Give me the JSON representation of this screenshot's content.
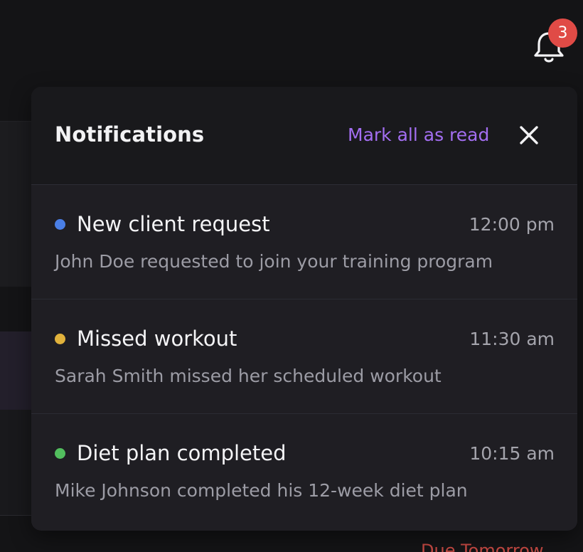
{
  "bell": {
    "icon": "bell-icon",
    "badge_count": "3",
    "badge_color": "#e04b46"
  },
  "background": {
    "due_label": "Due Tomorrow"
  },
  "panel": {
    "title": "Notifications",
    "mark_all_label": "Mark all as read",
    "accent_color": "#a36ef1",
    "close_icon": "close-icon"
  },
  "notifications": [
    {
      "title": "New client request",
      "time": "12:00 pm",
      "description": "John Doe requested to join your training program",
      "dot_color": "#4a7fe6"
    },
    {
      "title": "Missed workout",
      "time": "11:30 am",
      "description": "Sarah Smith missed her scheduled workout",
      "dot_color": "#e1b23c"
    },
    {
      "title": "Diet plan completed",
      "time": "10:15 am",
      "description": "Mike Johnson completed his 12-week diet plan",
      "dot_color": "#52be5e"
    }
  ]
}
